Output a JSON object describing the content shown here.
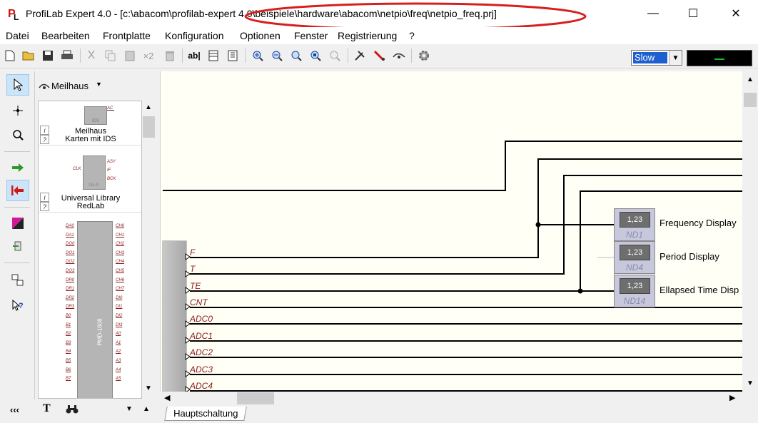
{
  "window": {
    "title": "ProfiLab Expert 4.0 - [c:\\abacom\\profilab-expert 4.0\\beispiele\\hardware\\abacom\\netpio\\freq\\netpio_freq.prj]",
    "minimize": "—",
    "maximize": "☐",
    "close": "✕"
  },
  "menu": [
    "Datei",
    "Bearbeiten",
    "Frontplatte",
    "Konfiguration",
    "Optionen",
    "Fenster",
    "Registrierung",
    "?"
  ],
  "toolbar": {
    "multiplier": "×2",
    "text_tool": "ab|",
    "speed": "Slow"
  },
  "library": {
    "selected": "Meilhaus",
    "items": [
      {
        "line1": "Meilhaus",
        "line2": "Karten mit IDS"
      },
      {
        "line1": "Universal Library",
        "line2": "RedLab"
      }
    ],
    "module_name": "PMD-1608",
    "pins_left": [
      "DA0",
      "DA1",
      "DO0",
      "DO1",
      "DO2",
      "DO3",
      "DR0",
      "DR1",
      "DR2",
      "DR3",
      "B0",
      "B1",
      "B2",
      "B3",
      "B4",
      "B5",
      "B6",
      "B7"
    ],
    "pins_right": [
      "CH0",
      "CH1",
      "CH2",
      "CH3",
      "CH4",
      "CH5",
      "CH6",
      "CH7",
      "DI0",
      "DI1",
      "DI2",
      "DI3",
      "A0",
      "A1",
      "A2",
      "A3",
      "A4",
      "A5"
    ],
    "ids_pin": "AC",
    "ids_label": "IDS",
    "ul_pins": [
      "ASY",
      "IF",
      "BCK"
    ],
    "ul_clk": "CLK",
    "ul_label": "UL-0"
  },
  "bottom_panel": {
    "collapse": "‹‹‹",
    "text_icon": "T"
  },
  "canvas": {
    "signals": [
      "F",
      "T",
      "TE",
      "CNT",
      "ADC0",
      "ADC1",
      "ADC2",
      "ADC3",
      "ADC4"
    ],
    "displays": [
      {
        "value": "1,23",
        "id": "ND1",
        "label": "Frequency Display"
      },
      {
        "value": "1,23",
        "id": "ND4",
        "label": "Period Display"
      },
      {
        "value": "1,23",
        "id": "ND14",
        "label": "Ellapsed Time Disp"
      }
    ]
  },
  "tabs": [
    "Hauptschaltung"
  ],
  "colors": {
    "canvas_bg": "#fffff6",
    "wire": "#000000",
    "annotation": "#d61f1f",
    "signal_text": "#8b1a1a"
  }
}
